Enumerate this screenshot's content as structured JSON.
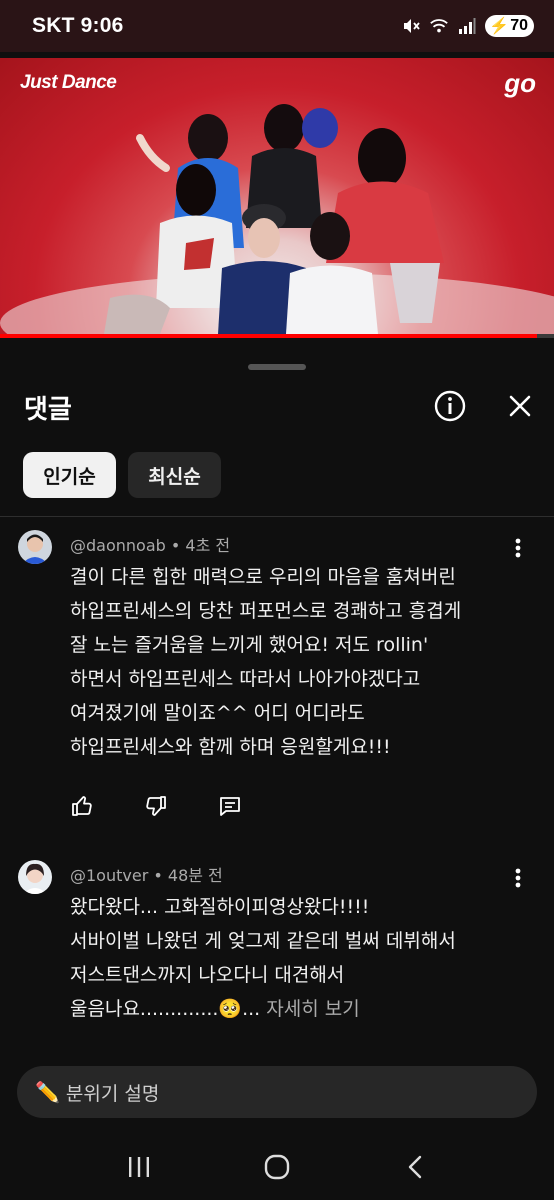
{
  "status": {
    "carrier": "SKT",
    "time": "9:06",
    "battery": "70"
  },
  "video": {
    "logo_left": "Just Dance",
    "logo_right": "go",
    "progress": 0.97
  },
  "sheet": {
    "title": "댓글",
    "chips": [
      {
        "label": "인기순",
        "selected": true
      },
      {
        "label": "최신순",
        "selected": false
      }
    ]
  },
  "comments": [
    {
      "author": "@daonnoab",
      "time": "4초 전",
      "lines": [
        "결이 다른 힙한 매력으로 우리의 마음을 훔쳐버린",
        "하입프린세스의 당찬 퍼포먼스로 경쾌하고 흥겹게",
        "잘 노는 즐거움을 느끼게 했어요! 저도 rollin'",
        "하면서 하입프린세스 따라서 나아가야겠다고",
        "여겨졌기에 말이죠^^ 어디 어디라도",
        "하입프린세스와 함께 하며 응원할게요!!!"
      ]
    },
    {
      "author": "@1outver",
      "time": "48분 전",
      "lines": [
        "왔다왔다... 고화질하이피영상왔다!!!!",
        "서바이벌 나왔던 게 엊그제 같은데 벌써 데뷔해서",
        "저스트댄스까지 나오다니 대견해서",
        "울음나요.............🥺..."
      ],
      "more": "자세히 보기"
    }
  ],
  "input": {
    "placeholder": "분위기 설명",
    "emoji": "✏️"
  }
}
